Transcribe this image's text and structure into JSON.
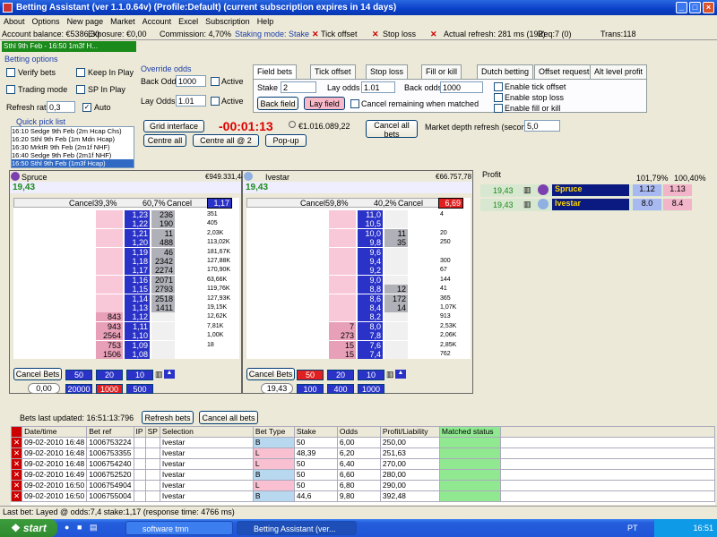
{
  "window": {
    "title": "Betting Assistant (ver 1.1.0.64v)    (Profile:Default)    (current subscription expires in 14 days)"
  },
  "menu": [
    "About",
    "Options",
    "New page",
    "Market",
    "Account",
    "Excel",
    "Subscription",
    "Help"
  ],
  "status": {
    "balance": "Account balance: €5386,30",
    "exposure": "Exposure: €0,00",
    "commission": "Commission: 4,70%",
    "staking": "Staking mode: Stake",
    "tick_offset": "Tick offset",
    "stop_loss": "Stop loss",
    "refresh": "Actual refresh: 281 ms (192)",
    "req": "Req:7 (0)",
    "trans": "Trans:118"
  },
  "market_tab": "Sthl 9th Feb - 16:50 1m3f H... ",
  "options": {
    "title": "Betting options",
    "verify": "Verify bets",
    "keep": "Keep In Play",
    "trading": "Trading mode",
    "sp": "SP In Play",
    "refresh_label": "Refresh rate",
    "refresh_val": "0,3",
    "auto": "Auto",
    "override": "Override odds",
    "back_odds_l": "Back Odds",
    "back_odds_v": "1000",
    "lay_odds_l": "Lay Odds",
    "lay_odds_v": "1.01",
    "active": "Active"
  },
  "tabs": [
    "Field bets",
    "Tick offset",
    "Stop loss",
    "Fill or kill",
    "Dutch betting",
    "Offset requests",
    "Alt level profit"
  ],
  "fieldbets": {
    "stake_l": "Stake",
    "stake_v": "2",
    "lay_odds_l": "Lay odds",
    "lay_odds_v": "1.01",
    "back_odds_l": "Back odds",
    "back_odds_v": "1000",
    "back_btn": "Back field",
    "lay_btn": "Lay field",
    "cancel_rem": "Cancel remaining when matched",
    "en_tick": "Enable tick offset",
    "en_stop": "Enable stop loss",
    "en_fill": "Enable fill or kill"
  },
  "quick": {
    "title": "Quick pick list",
    "items": [
      "16:10 Sedge 9th Feb (2m Hcap Chs)",
      "16:20 Sthl 9th Feb (1m Mdn Hcap)",
      "16:30 MrktR 9th Feb (2m1f NHF)",
      "16:40 Sedge 9th Feb (2m1f NHF)",
      "16:50 Sthl 9th Feb (1m3f Hcap)"
    ]
  },
  "controls": {
    "grid": "Grid interface",
    "centre": "Centre all",
    "centre2": "Centre all @ 2",
    "popup": "Pop-up",
    "timer": "-00:01:13",
    "matched": "€1.016.089,22",
    "cancel_all": "Cancel all bets",
    "depth_l": "Market depth refresh (seconds)",
    "depth_v": "5,0"
  },
  "runner1": {
    "name": "Spruce",
    "matched": "€949.331,44",
    "ltp": "19,43",
    "cancel": "Cancel",
    "pct_back": "39,3%",
    "pct_lay": "60,7%",
    "best": "1,17",
    "odds": [
      "1,23",
      "1,22",
      "1,21",
      "1,20",
      "1,19",
      "1,18",
      "1,17",
      "1,16",
      "1,15",
      "1,14",
      "1,13",
      "1,12",
      "1,11",
      "1,10",
      "1,09",
      "1,08"
    ],
    "back": [
      "",
      "",
      "",
      "",
      "",
      "",
      "",
      "",
      "",
      "",
      "",
      "843",
      "943",
      "2564",
      "753",
      "1506"
    ],
    "lay": [
      "236",
      "190",
      "11",
      "488",
      "46",
      "2342",
      "2274",
      "2071",
      "2793",
      "2518",
      "1411",
      "",
      "",
      "",
      "",
      ""
    ],
    "vol": [
      "351",
      "405",
      "2,03K",
      "113,02K",
      "181,67K",
      "127,88K",
      "170,90K",
      "63,66K",
      "119,76K",
      "127,93K",
      "19,15K",
      "12,62K",
      "7,81K",
      "1,00K",
      "18",
      ""
    ],
    "cancel_bets": "Cancel Bets",
    "stakes": [
      "50",
      "20",
      "10"
    ],
    "pl": "0,00",
    "stakes2": [
      "20000",
      "1000",
      "500"
    ]
  },
  "runner2": {
    "name": "Ivestar",
    "matched": "€66.757,78",
    "ltp": "19,43",
    "cancel": "Cancel",
    "pct_back": "59,8%",
    "pct_lay": "40,2%",
    "best": "6,69",
    "odds": [
      "11,0",
      "10,5",
      "10,0",
      "9,8",
      "9,6",
      "9,4",
      "9,2",
      "9,0",
      "8,8",
      "8,6",
      "8,4",
      "8,2",
      "8,0",
      "7,8",
      "7,6",
      "7,4"
    ],
    "back": [
      "",
      "",
      "",
      "",
      "",
      "",
      "",
      "",
      "",
      "",
      "",
      "",
      "7",
      "273",
      "15",
      "15"
    ],
    "lay": [
      "",
      "",
      "11",
      "35",
      "",
      "",
      "",
      "",
      "12",
      "172",
      "14",
      "",
      "",
      "",
      "",
      ""
    ],
    "vol": [
      "4",
      "",
      "20",
      "250",
      "",
      "300",
      "67",
      "144",
      "41",
      "365",
      "1,07K",
      "913",
      "2,53K",
      "2,06K",
      "2,85K",
      "762"
    ],
    "cancel_bets": "Cancel Bets",
    "stakes": [
      "50",
      "20",
      "10"
    ],
    "pl": "19,43",
    "stakes2": [
      "100",
      "400",
      "1000"
    ]
  },
  "profit": {
    "title": "Profit",
    "col1": "101,79%",
    "col2": "100,40%",
    "rows": [
      {
        "pl": "19,43",
        "name": "Spruce",
        "back": "1.12",
        "lay": "1.13"
      },
      {
        "pl": "19,43",
        "name": "Ivestar",
        "back": "8.0",
        "lay": "8.4"
      }
    ]
  },
  "bets": {
    "last": "Bets last updated: 16:51:13:796",
    "refresh": "Refresh bets",
    "cancel": "Cancel all bets",
    "headers": [
      "Date/time",
      "Bet ref",
      "IP",
      "SP",
      "Selection",
      "Bet Type",
      "Stake",
      "Odds",
      "Profit/Liability",
      "Matched status"
    ],
    "rows": [
      [
        "09-02-2010 16:48",
        "1006753224",
        "",
        "",
        "Ivestar",
        "B",
        "50",
        "6,00",
        "250,00",
        ""
      ],
      [
        "09-02-2010 16:48",
        "1006753355",
        "",
        "",
        "Ivestar",
        "L",
        "48,39",
        "6,20",
        "251,63",
        ""
      ],
      [
        "09-02-2010 16:48",
        "1006754240",
        "",
        "",
        "Ivestar",
        "L",
        "50",
        "6,40",
        "270,00",
        ""
      ],
      [
        "09-02-2010 16:49",
        "1006752520",
        "",
        "",
        "Ivestar",
        "B",
        "50",
        "6,60",
        "280,00",
        ""
      ],
      [
        "09-02-2010 16:50",
        "1006754904",
        "",
        "",
        "Ivestar",
        "L",
        "50",
        "6,80",
        "290,00",
        ""
      ],
      [
        "09-02-2010 16:50",
        "1006755004",
        "",
        "",
        "Ivestar",
        "B",
        "44,6",
        "9,80",
        "392,48",
        ""
      ]
    ]
  },
  "lastbet": "Last bet: Layed  @ odds:7,4  stake:1,17  (response time: 4766 ms)",
  "taskbar": {
    "start": "start",
    "task1": "software tmn",
    "task2": "Betting Assistant (ver...",
    "lang": "PT",
    "clock": "16:51"
  }
}
